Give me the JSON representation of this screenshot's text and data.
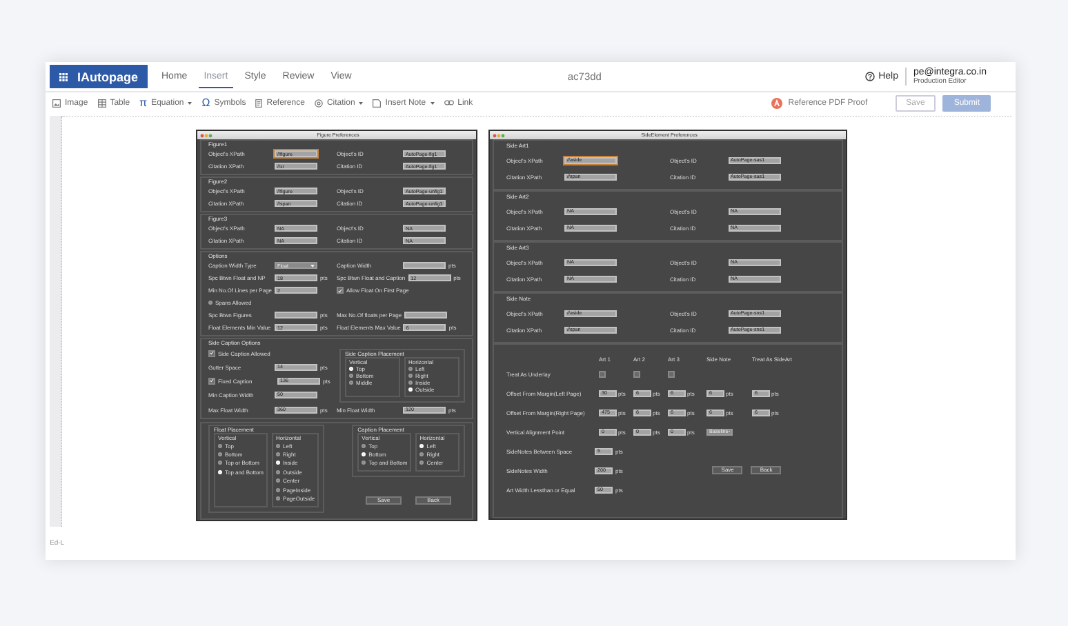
{
  "app": {
    "logo": "IAutopage",
    "menu": [
      {
        "label": "Home",
        "selected": false
      },
      {
        "label": "Insert",
        "selected": true
      },
      {
        "label": "Style",
        "selected": false
      },
      {
        "label": "Review",
        "selected": false
      },
      {
        "label": "View",
        "selected": false
      }
    ],
    "document": "ac73dd",
    "help": "Help",
    "user": {
      "email": "pe@integra.co.in",
      "role": "Production Editor"
    }
  },
  "toolbar": {
    "items": [
      {
        "label": "Image",
        "dropdown": false
      },
      {
        "label": "Table",
        "dropdown": false
      },
      {
        "label": "Equation",
        "glyph": "π",
        "dropdown": true
      },
      {
        "label": "Symbols",
        "glyph": "Ω",
        "dropdown": false
      },
      {
        "label": "Reference",
        "dropdown": false
      },
      {
        "label": "Citation",
        "dropdown": true
      },
      {
        "label": "Insert Note",
        "dropdown": true
      },
      {
        "label": "Link",
        "dropdown": false
      }
    ],
    "proof": "Reference PDF Proof",
    "buttons": [
      {
        "label": "Save",
        "kind": "outline"
      },
      {
        "label": "Submit",
        "kind": "primary"
      }
    ]
  },
  "figure_dialog": {
    "title": "Figure Preferences",
    "groups": [
      {
        "title": "Figure1",
        "rows": [
          [
            {
              "kind": "field",
              "label": "Object's XPath",
              "value": "//figure",
              "focused": true
            },
            {
              "kind": "field",
              "label": "Object's ID",
              "value": "AutoPage-fig1"
            }
          ],
          [
            {
              "kind": "field",
              "label": "Citation XPath",
              "value": "//xr"
            },
            {
              "kind": "field",
              "label": "Citation ID",
              "value": "AutoPage-fig1"
            }
          ]
        ]
      },
      {
        "title": "Figure2",
        "rows": [
          [
            {
              "kind": "field",
              "label": "Object's XPath",
              "value": "//figure"
            },
            {
              "kind": "field",
              "label": "Object's ID",
              "value": "AutoPage-unfig1"
            }
          ],
          [
            {
              "kind": "field",
              "label": "Citation XPath",
              "value": "//span"
            },
            {
              "kind": "field",
              "label": "Citation ID",
              "value": "AutoPage-unfig1"
            }
          ]
        ]
      },
      {
        "title": "Figure3",
        "rows": [
          [
            {
              "kind": "field",
              "label": "Object's XPath",
              "value": "NA"
            },
            {
              "kind": "field",
              "label": "Object's ID",
              "value": "NA"
            }
          ],
          [
            {
              "kind": "field",
              "label": "Citation XPath",
              "value": "NA"
            },
            {
              "kind": "field",
              "label": "Citation ID",
              "value": "NA"
            }
          ]
        ]
      },
      {
        "title": "Options",
        "rows": [
          [
            {
              "kind": "select",
              "label": "Caption Width Type",
              "value": "Float"
            },
            {
              "kind": "field",
              "label": "Caption Width",
              "unit": "pts"
            }
          ],
          [
            {
              "kind": "field",
              "label": "Spc Btwn Float and NP",
              "value": "18",
              "unit": "pts"
            },
            {
              "kind": "field",
              "label": "Spc Btwn Float and Caption",
              "value": "12",
              "unit": "pts"
            }
          ],
          [
            {
              "kind": "field",
              "label": "Min No.Of Lines per Page",
              "value": "2"
            },
            {
              "kind": "check",
              "label": "Allow Float On First Page",
              "checked": true
            }
          ],
          [
            {
              "kind": "radio",
              "label": "Spans Allowed",
              "selected": false
            }
          ],
          [
            {
              "kind": "field",
              "label": "Spc Btwn Figures",
              "unit": "pts"
            },
            {
              "kind": "field",
              "label": "Max No.Of floats per Page"
            }
          ],
          [
            {
              "kind": "field",
              "label": "Float Elements Min Value",
              "value": "12",
              "unit": "pts"
            },
            {
              "kind": "field",
              "label": "Float Elements Max Value",
              "value": "6",
              "unit": "pts"
            }
          ]
        ]
      }
    ],
    "side_caption": {
      "title": "Side Caption Options",
      "rows": [
        {
          "kind": "check",
          "label": "Side Caption Allowed",
          "checked": true
        },
        {
          "kind": "field",
          "label": "Gutter Space",
          "value": "14",
          "unit": "pts"
        },
        {
          "kind": "checkfield",
          "label": "Fixed Caption",
          "checked": true,
          "value": "136",
          "unit": "pts"
        },
        {
          "kind": "field",
          "label": "Min Caption Width",
          "value": "50"
        }
      ],
      "placement": {
        "title": "Side Caption Placement",
        "columns": [
          {
            "title": "Vertical",
            "options": [
              {
                "label": "Top",
                "selected": true
              },
              {
                "label": "Bottom",
                "selected": false
              },
              {
                "label": "Middle",
                "selected": false
              }
            ]
          },
          {
            "title": "Horizontal",
            "options": [
              {
                "label": "Left",
                "selected": false
              },
              {
                "label": "Right",
                "selected": false
              },
              {
                "label": "Inside",
                "selected": false
              },
              {
                "label": "Outside",
                "selected": true
              }
            ]
          }
        ]
      },
      "bottom_row": [
        {
          "kind": "field",
          "label": "Max Float Width",
          "value": "360",
          "unit": "pts"
        },
        {
          "kind": "field",
          "label": "Min Float Width",
          "value": "120",
          "unit": "pts"
        }
      ]
    },
    "placements": [
      {
        "title": "Float Placement",
        "columns": [
          {
            "title": "Vertical",
            "options": [
              {
                "label": "Top",
                "selected": false
              },
              {
                "label": "Bottom",
                "selected": false
              },
              {
                "label": "Top or Bottom",
                "selected": false
              },
              {
                "label": "Top and Bottom",
                "selected": true
              }
            ]
          },
          {
            "title": "Horizontal",
            "options": [
              {
                "label": "Left",
                "selected": false
              },
              {
                "label": "Right",
                "selected": false
              },
              {
                "label": "Inside",
                "selected": true
              },
              {
                "label": "Outside",
                "selected": false
              },
              {
                "label": "Center",
                "selected": false
              },
              {
                "label": "PageInside",
                "selected": false
              },
              {
                "label": "PageOutside",
                "selected": false
              }
            ]
          }
        ]
      },
      {
        "title": "Caption Placement",
        "columns": [
          {
            "title": "Vertical",
            "options": [
              {
                "label": "Top",
                "selected": false
              },
              {
                "label": "Bottom",
                "selected": true
              },
              {
                "label": "Top and Bottom",
                "selected": false
              }
            ]
          },
          {
            "title": "Horizontal",
            "options": [
              {
                "label": "Left",
                "selected": true
              },
              {
                "label": "Right",
                "selected": false
              },
              {
                "label": "Center",
                "selected": false
              }
            ]
          }
        ]
      }
    ],
    "buttons": [
      "Save",
      "Back"
    ]
  },
  "side_dialog": {
    "title": "SideElement Preferences",
    "groups": [
      {
        "title": "Side Art1",
        "rows": [
          [
            {
              "kind": "field",
              "label": "Object's XPath",
              "value": "//aside",
              "focused": true
            },
            {
              "kind": "field",
              "label": "Object's ID",
              "value": "AutoPage-sas1"
            }
          ],
          [
            {
              "kind": "field",
              "label": "Citation XPath",
              "value": "//span"
            },
            {
              "kind": "field",
              "label": "Citation ID",
              "value": "AutoPage-sas1"
            }
          ]
        ]
      },
      {
        "title": "Side Art2",
        "rows": [
          [
            {
              "kind": "field",
              "label": "Object's XPath",
              "value": "NA"
            },
            {
              "kind": "field",
              "label": "Object's ID",
              "value": "NA"
            }
          ],
          [
            {
              "kind": "field",
              "label": "Citation XPath",
              "value": "NA"
            },
            {
              "kind": "field",
              "label": "Citation ID",
              "value": "NA"
            }
          ]
        ]
      },
      {
        "title": "Side Art3",
        "rows": [
          [
            {
              "kind": "field",
              "label": "Object's XPath",
              "value": "NA"
            },
            {
              "kind": "field",
              "label": "Object's ID",
              "value": "NA"
            }
          ],
          [
            {
              "kind": "field",
              "label": "Citation XPath",
              "value": "NA"
            },
            {
              "kind": "field",
              "label": "Citation ID",
              "value": "NA"
            }
          ]
        ]
      },
      {
        "title": "Side Note",
        "rows": [
          [
            {
              "kind": "field",
              "label": "Object's XPath",
              "value": "//aside"
            },
            {
              "kind": "field",
              "label": "Object's ID",
              "value": "AutoPage-sns1"
            }
          ],
          [
            {
              "kind": "field",
              "label": "Citation XPath",
              "value": "//span"
            },
            {
              "kind": "field",
              "label": "Citation ID",
              "value": "AutoPage-sns1"
            }
          ]
        ]
      }
    ],
    "table": {
      "columns": [
        "Art 1",
        "Art 2",
        "Art 3",
        "Side Note",
        "Treat As SideArt"
      ],
      "rows": [
        {
          "label": "Treat As Underlay",
          "cells": [
            {
              "kind": "checkbox",
              "checked": false
            },
            {
              "kind": "checkbox",
              "checked": false
            },
            {
              "kind": "checkbox",
              "checked": false
            }
          ]
        },
        {
          "label": "Offset From Margin(Left Page)",
          "cells": [
            {
              "kind": "field",
              "value": "30",
              "unit": "pts"
            },
            {
              "kind": "field",
              "value": "6",
              "unit": "pts"
            },
            {
              "kind": "field",
              "value": "6",
              "unit": "pts"
            },
            {
              "kind": "field",
              "value": "6",
              "unit": "pts"
            },
            {
              "kind": "field",
              "value": "6",
              "unit": "pts"
            }
          ]
        },
        {
          "label": "Offset From Margin(Right Page)",
          "cells": [
            {
              "kind": "field",
              "value": "475",
              "unit": "pts"
            },
            {
              "kind": "field",
              "value": "6",
              "unit": "pts"
            },
            {
              "kind": "field",
              "value": "6",
              "unit": "pts"
            },
            {
              "kind": "field",
              "value": "6",
              "unit": "pts"
            },
            {
              "kind": "field",
              "value": "6",
              "unit": "pts"
            }
          ]
        },
        {
          "label": "Vertical Alignment Point",
          "cells": [
            {
              "kind": "field",
              "value": "0",
              "unit": "pts"
            },
            {
              "kind": "field",
              "value": "0",
              "unit": "pts"
            },
            {
              "kind": "field",
              "value": "0",
              "unit": "pts"
            },
            {
              "kind": "select",
              "value": "Baseline"
            }
          ]
        }
      ]
    },
    "rows": [
      {
        "kind": "field",
        "label": "SideNotes Between Space",
        "value": "5",
        "unit": "pts"
      },
      {
        "kind": "field",
        "label": "SideNotes Width",
        "value": "200",
        "unit": "pts"
      },
      {
        "kind": "field",
        "label": "Art Width Lessthan or Equal",
        "value": "50",
        "unit": "pts"
      }
    ],
    "buttons": [
      "Save",
      "Back"
    ]
  },
  "footer": "Ed-L"
}
